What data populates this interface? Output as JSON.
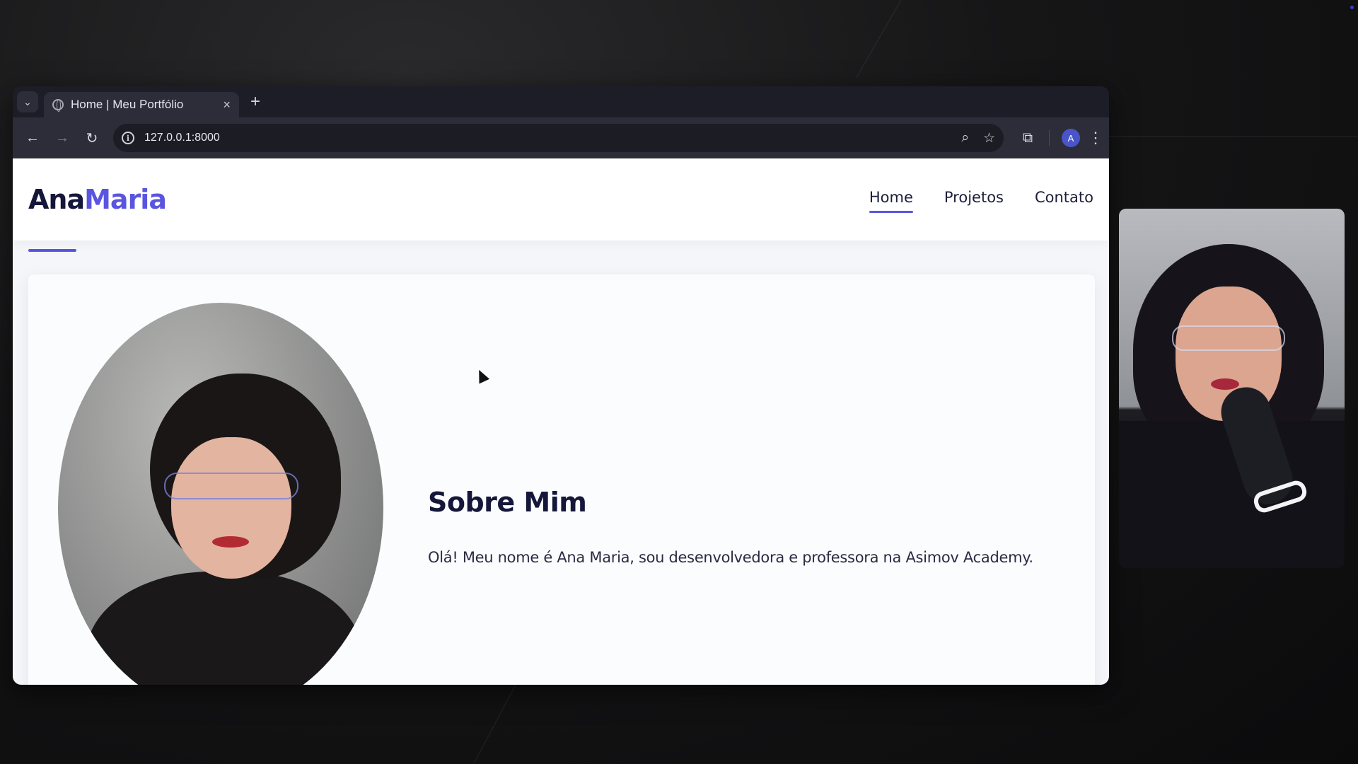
{
  "browser": {
    "tab": {
      "title": "Home | Meu Portfólio",
      "close_glyph": "×"
    },
    "new_tab_glyph": "+",
    "tab_menu_glyph": "⌄",
    "url": "127.0.0.1:8000",
    "profile_initial": "A",
    "icons": {
      "back": "←",
      "forward": "→",
      "reload": "↻",
      "zoom": "⌕",
      "bookmark": "☆",
      "extensions": "⧉",
      "menu": "⋮",
      "info": "i"
    }
  },
  "site": {
    "logo_primary": "Ana",
    "logo_accent": "Maria",
    "nav": [
      {
        "label": "Home",
        "active": true
      },
      {
        "label": "Projetos",
        "active": false
      },
      {
        "label": "Contato",
        "active": false
      }
    ],
    "about": {
      "title": "Sobre Mim",
      "text": "Olá! Meu nome é Ana Maria, sou desenvolvedora e professora na Asimov Academy."
    }
  },
  "colors": {
    "accent": "#5a55e0",
    "heading": "#15173a",
    "browser_bg": "#2c2d38"
  }
}
